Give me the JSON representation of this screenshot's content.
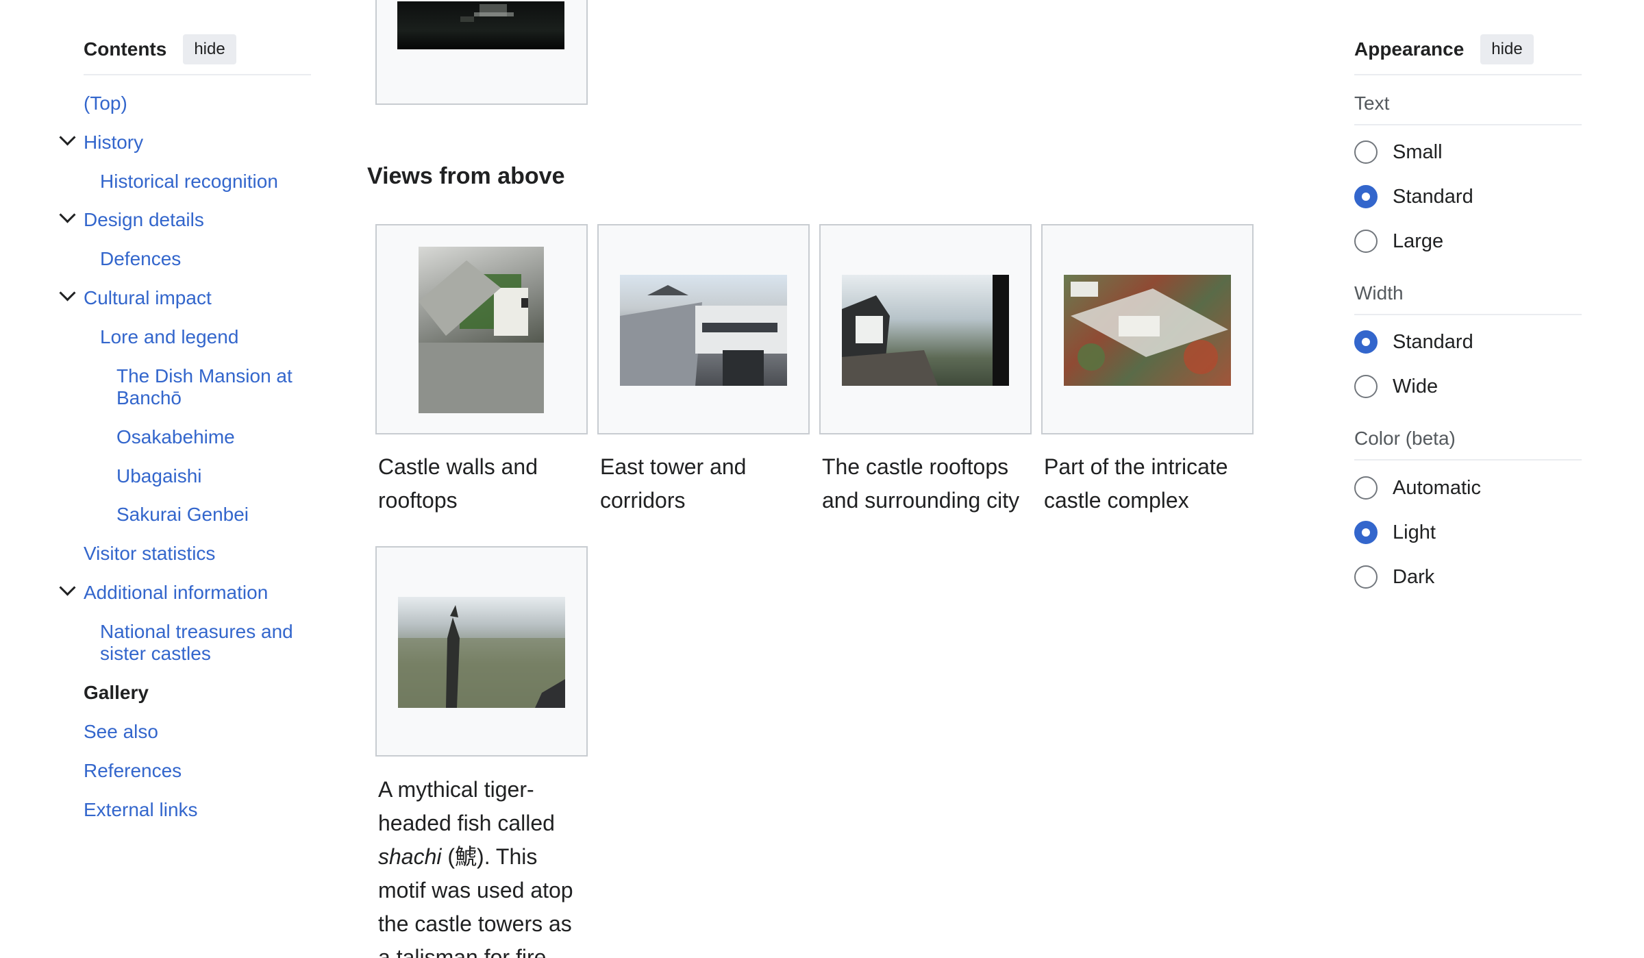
{
  "toc": {
    "title": "Contents",
    "hide_label": "hide",
    "items": [
      {
        "label": "(Top)"
      },
      {
        "label": "History"
      },
      {
        "label": "Historical recognition"
      },
      {
        "label": "Design details"
      },
      {
        "label": "Defences"
      },
      {
        "label": "Cultural impact"
      },
      {
        "label": "Lore and legend"
      },
      {
        "label": "The Dish Mansion at Banchō"
      },
      {
        "label": "Osakabehime"
      },
      {
        "label": "Ubagaishi"
      },
      {
        "label": "Sakurai Genbei"
      },
      {
        "label": "Visitor statistics"
      },
      {
        "label": "Additional information"
      },
      {
        "label": "National treasures and sister castles"
      },
      {
        "label": "Gallery"
      },
      {
        "label": "See also"
      },
      {
        "label": "References"
      },
      {
        "label": "External links"
      }
    ]
  },
  "gallery": {
    "section_title": "Views from above",
    "captions": [
      "Castle walls and rooftops",
      "East tower and corridors",
      "The castle rooftops and surrounding city",
      "Part of the intricate castle complex"
    ],
    "shachi_caption": {
      "before": "A mythical tiger-headed fish called ",
      "italic": "shachi",
      "after": " (鯱). This motif was used atop the castle towers as a talisman for fire"
    }
  },
  "appearance": {
    "title": "Appearance",
    "hide_label": "hide",
    "text_label": "Text",
    "text_options": [
      "Small",
      "Standard",
      "Large"
    ],
    "text_selected": "Standard",
    "width_label": "Width",
    "width_options": [
      "Standard",
      "Wide"
    ],
    "width_selected": "Standard",
    "color_label": "Color (beta)",
    "color_options": [
      "Automatic",
      "Light",
      "Dark"
    ],
    "color_selected": "Light"
  }
}
